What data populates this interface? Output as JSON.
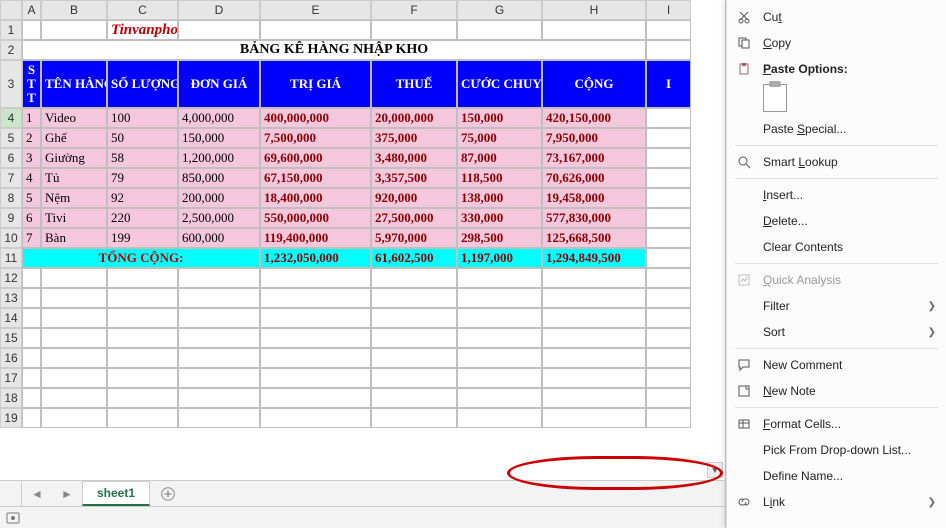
{
  "brand": "Tinvanphong.com",
  "title": "BẢNG KÊ HÀNG NHẬP KHO",
  "cols": [
    "A",
    "B",
    "C",
    "D",
    "E",
    "F",
    "G",
    "H",
    "I"
  ],
  "headers": {
    "A": "S\nT\nT",
    "B": "TÊN HÀNG",
    "C": "SỐ LƯỢNG",
    "D": "ĐƠN GIÁ",
    "E": "TRỊ GIÁ",
    "F": "THUẾ",
    "G": "CƯỚC CHUYÊN CHỞ",
    "H": "CỘNG",
    "I": "I"
  },
  "rowlabels": [
    "1",
    "2",
    "3",
    "4",
    "5",
    "6",
    "7",
    "8",
    "9",
    "10",
    "11",
    "12",
    "13",
    "14",
    "15",
    "16",
    "17",
    "18",
    "19"
  ],
  "rows": [
    {
      "n": "1",
      "name": "Video",
      "qty": "100",
      "price": "4,000,000",
      "val": "400,000,000",
      "tax": "20,000,000",
      "ship": "150,000",
      "total": "420,150,000"
    },
    {
      "n": "2",
      "name": "Ghế",
      "qty": "50",
      "price": "150,000",
      "val": "7,500,000",
      "tax": "375,000",
      "ship": "75,000",
      "total": "7,950,000"
    },
    {
      "n": "3",
      "name": "Giường",
      "qty": "58",
      "price": "1,200,000",
      "val": "69,600,000",
      "tax": "3,480,000",
      "ship": "87,000",
      "total": "73,167,000"
    },
    {
      "n": "4",
      "name": "Tủ",
      "qty": "79",
      "price": "850,000",
      "val": "67,150,000",
      "tax": "3,357,500",
      "ship": "118,500",
      "total": "70,626,000"
    },
    {
      "n": "5",
      "name": "Nệm",
      "qty": "92",
      "price": "200,000",
      "val": "18,400,000",
      "tax": "920,000",
      "ship": "138,000",
      "total": "19,458,000"
    },
    {
      "n": "6",
      "name": "Tivi",
      "qty": "220",
      "price": "2,500,000",
      "val": "550,000,000",
      "tax": "27,500,000",
      "ship": "330,000",
      "total": "577,830,000"
    },
    {
      "n": "7",
      "name": "Bàn",
      "qty": "199",
      "price": "600,000",
      "val": "119,400,000",
      "tax": "5,970,000",
      "ship": "298,500",
      "total": "125,668,500"
    }
  ],
  "totals": {
    "label": "TỔNG CỘNG:",
    "val": "1,232,050,000",
    "tax": "61,602,500",
    "ship": "1,197,000",
    "total": "1,294,849,500"
  },
  "tab": "sheet1",
  "menu": {
    "cut": "Cut",
    "copy": "Copy",
    "paste_options": "Paste Options:",
    "paste_special": "Paste Special...",
    "smart_lookup": "Smart Lookup",
    "insert": "Insert...",
    "delete": "Delete...",
    "clear": "Clear Contents",
    "quick": "Quick Analysis",
    "filter": "Filter",
    "sort": "Sort",
    "new_comment": "New Comment",
    "new_note": "New Note",
    "format": "Format Cells...",
    "pick": "Pick From Drop-down List...",
    "define": "Define Name...",
    "link": "Link"
  },
  "u": {
    "cut": "t",
    "copy": "C",
    "paste_options": "P",
    "paste_special": "S",
    "smart_lookup": "L",
    "insert": "I",
    "delete": "D",
    "clear": "N",
    "quick": "Q",
    "filter": "E",
    "sort": "O",
    "new_comment": "M",
    "new_note": "N",
    "format": "F",
    "pick": "K",
    "define": "A",
    "link": "i"
  }
}
